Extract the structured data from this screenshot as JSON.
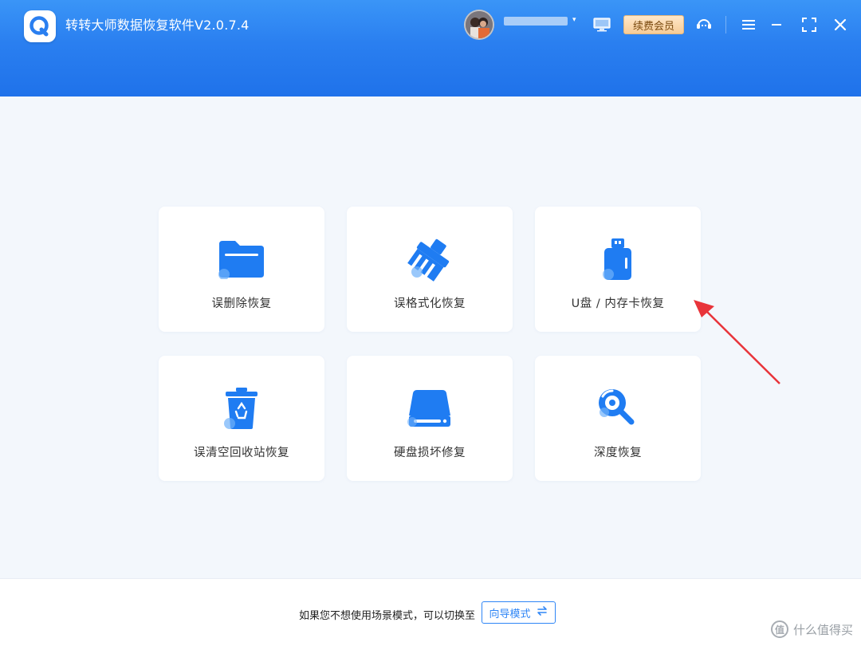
{
  "app": {
    "title": "转转大师数据恢复软件V2.0.7.4",
    "logo_icon": "app-logo-icon"
  },
  "header": {
    "user_avatar_icon": "user-avatar",
    "username_caret": "▾",
    "screen_icon": "monitor-icon",
    "vip_label": "续费会员",
    "support_icon": "customer-service-icon",
    "menu_icon": "menu-icon",
    "minimize_icon": "minimize-icon",
    "fullscreen_icon": "fullscreen-icon",
    "close_icon": "close-icon"
  },
  "modes": [
    {
      "label": "误删除恢复",
      "icon": "folder-icon"
    },
    {
      "label": "误格式化恢复",
      "icon": "brush-icon"
    },
    {
      "label": "U盘 / 内存卡恢复",
      "icon": "usb-drive-icon"
    },
    {
      "label": "误清空回收站恢复",
      "icon": "recycle-bin-icon"
    },
    {
      "label": "硬盘损坏修复",
      "icon": "hard-disk-icon"
    },
    {
      "label": "深度恢复",
      "icon": "deep-scan-icon"
    }
  ],
  "footer": {
    "hint_text": "如果您不想使用场景模式，可以切换至",
    "guide_button": "向导模式",
    "guide_icon": "switch-arrows-icon"
  },
  "watermark": {
    "glyph": "值",
    "text": "什么值得买"
  },
  "colors": {
    "header_blue": "#2a7ff0",
    "icon_blue": "#1f7cf2",
    "vip_gold": "#f6cc97",
    "annotation_red": "#e8343a"
  }
}
